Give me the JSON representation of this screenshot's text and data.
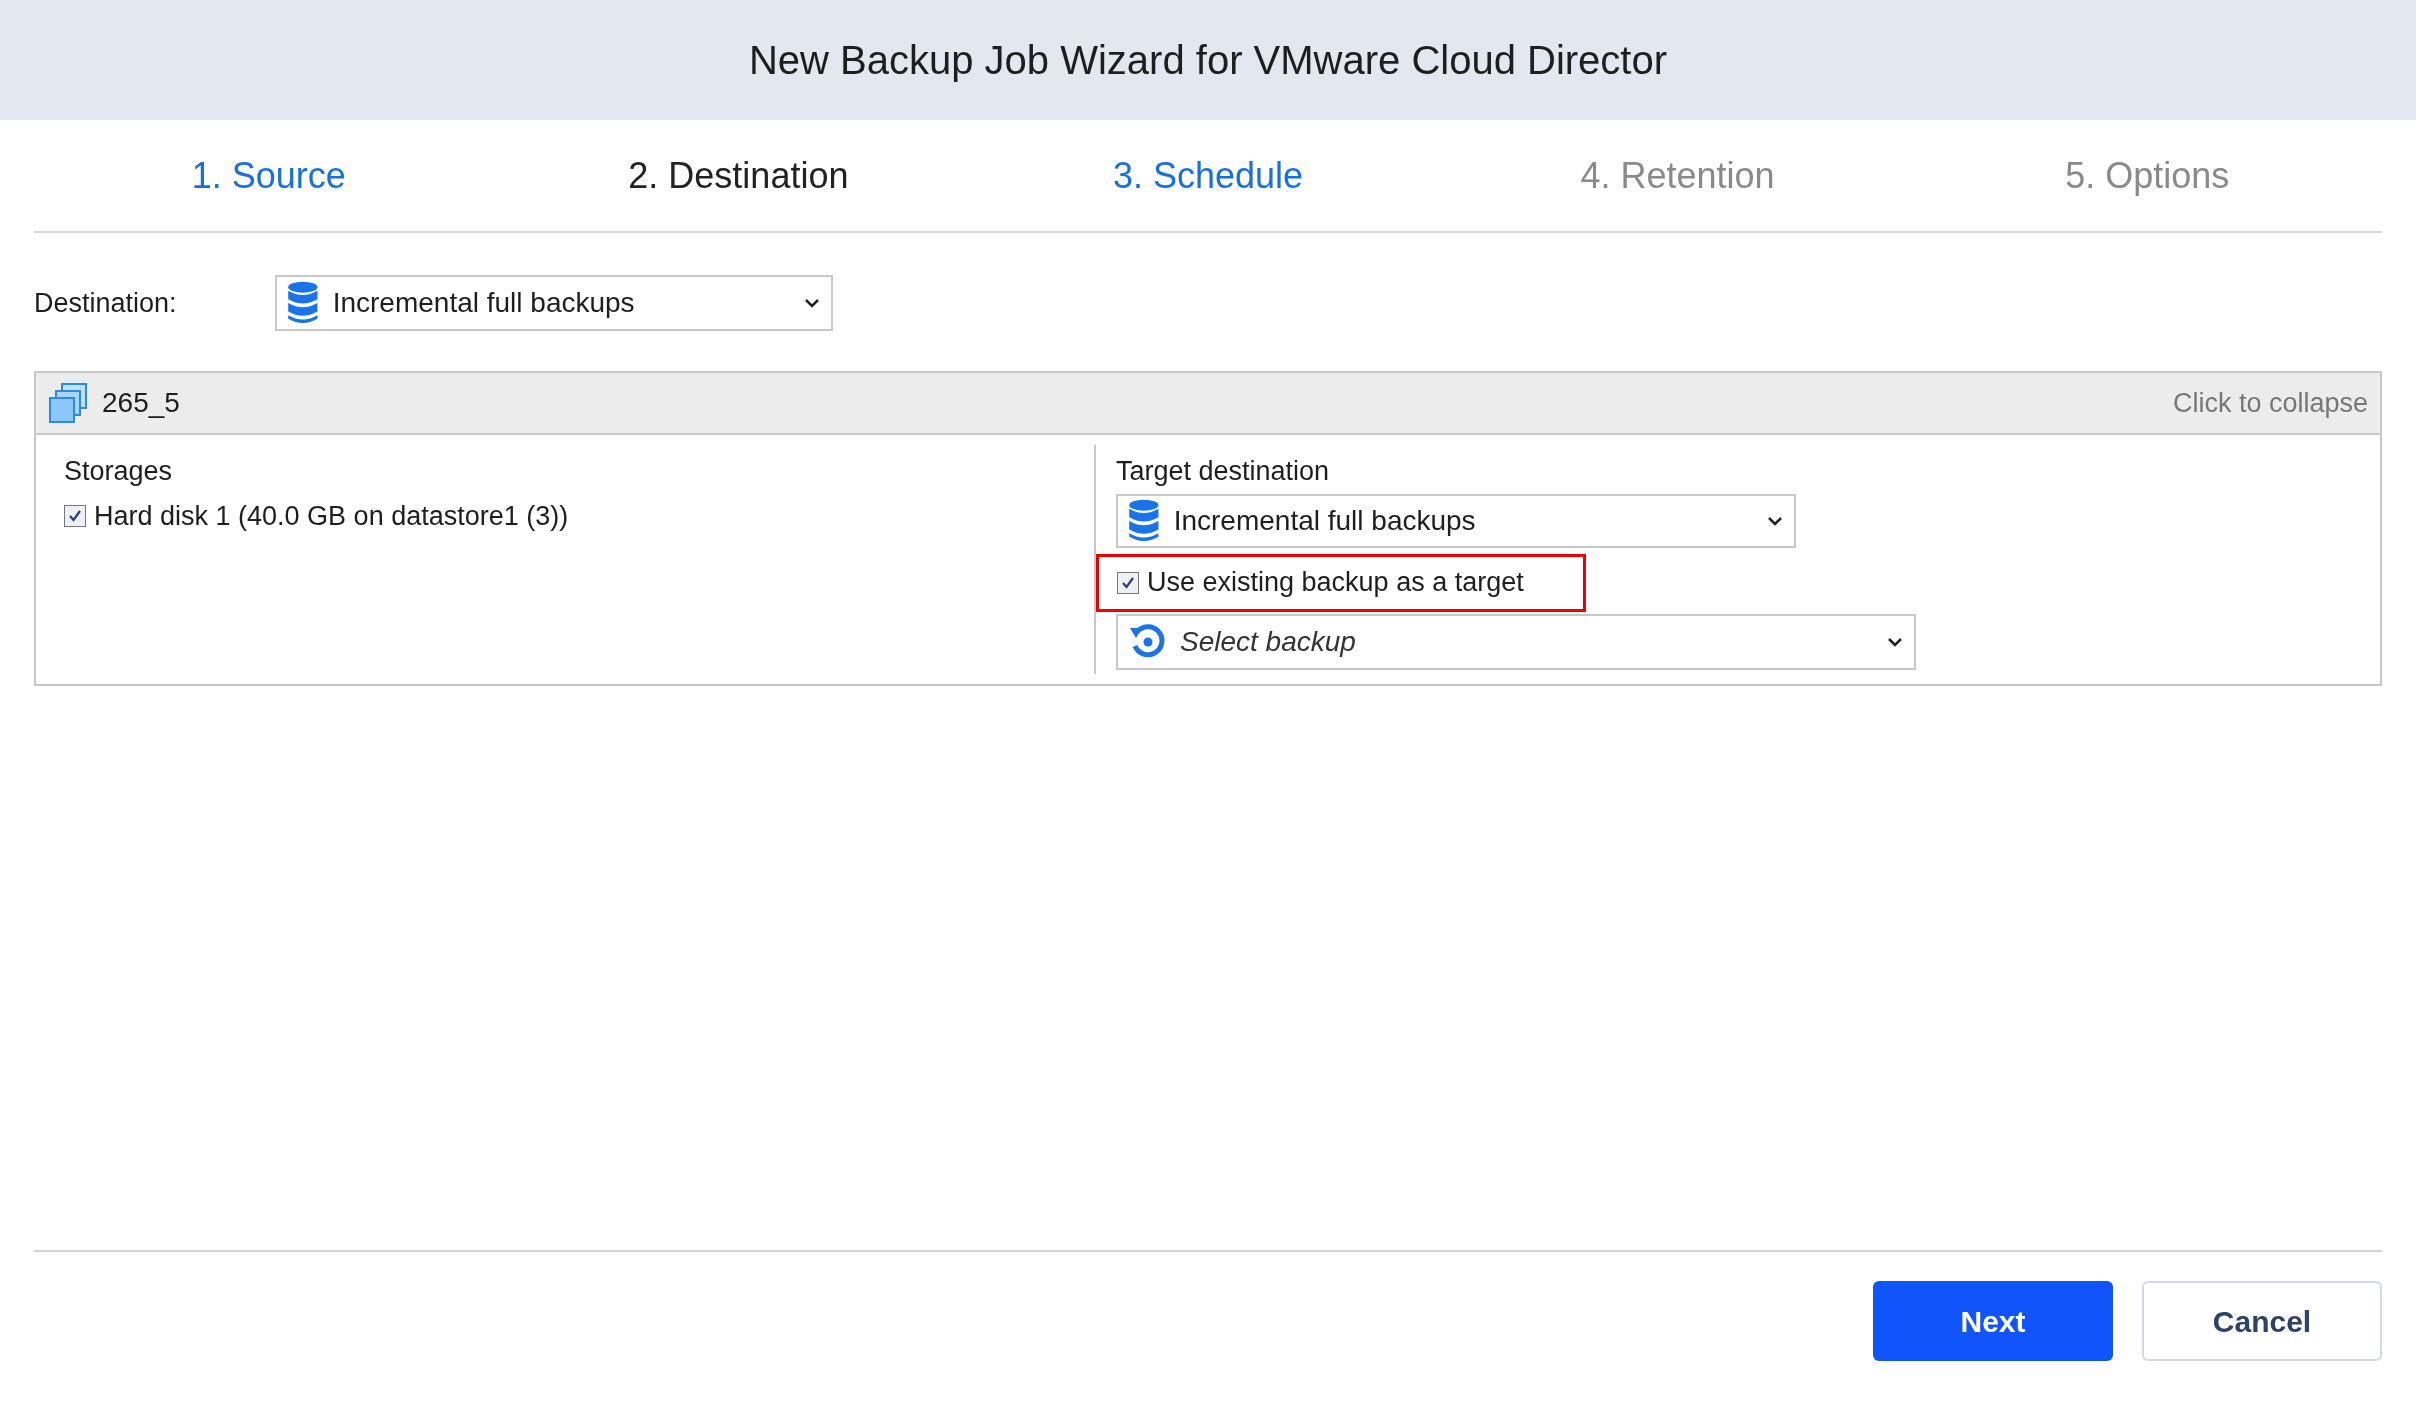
{
  "window": {
    "title": "New Backup Job Wizard for VMware Cloud Director"
  },
  "steps": [
    {
      "label": "1. Source",
      "selected": false,
      "disabled": false
    },
    {
      "label": "2. Destination",
      "selected": true,
      "disabled": false
    },
    {
      "label": "3. Schedule",
      "selected": false,
      "disabled": false
    },
    {
      "label": "4. Retention",
      "selected": false,
      "disabled": true
    },
    {
      "label": "5. Options",
      "selected": false,
      "disabled": true
    }
  ],
  "destination": {
    "label": "Destination:",
    "value": "Incremental full backups"
  },
  "vm_panel": {
    "name": "265_5",
    "collapse_hint": "Click to collapse",
    "expanded": true,
    "storages": {
      "title": "Storages",
      "items": [
        {
          "label": "Hard disk 1 (40.0 GB on datastore1 (3))",
          "checked": true
        }
      ]
    },
    "target": {
      "label": "Target destination",
      "value": "Incremental full backups",
      "use_existing": {
        "label": "Use existing backup as a target",
        "checked": true,
        "highlighted": true
      },
      "backup_select": {
        "placeholder": "Select backup"
      }
    }
  },
  "buttons": {
    "next": "Next",
    "cancel": "Cancel"
  }
}
